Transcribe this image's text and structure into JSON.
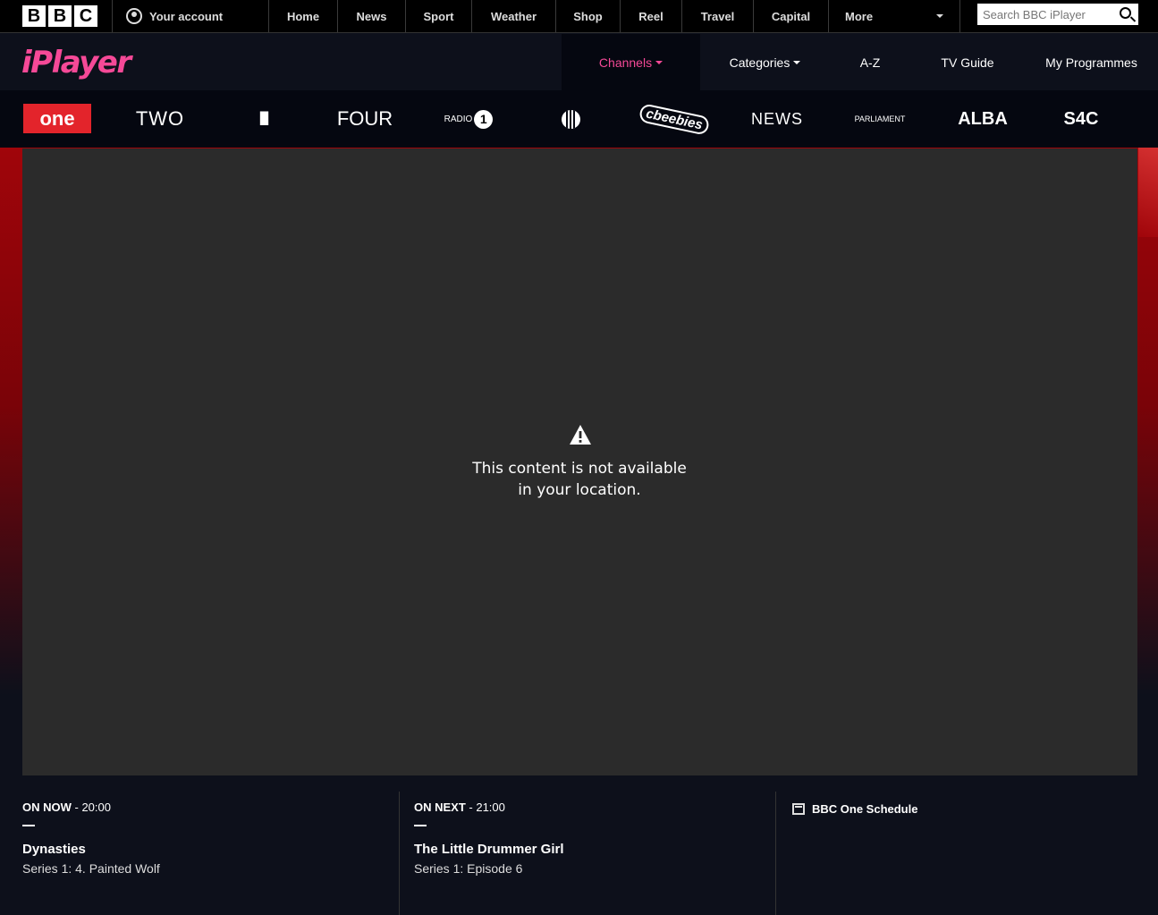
{
  "global_nav": {
    "bbc_letters": [
      "B",
      "B",
      "C"
    ],
    "account_label": "Your account",
    "items": [
      "Home",
      "News",
      "Sport",
      "Weather",
      "Shop",
      "Reel",
      "Travel",
      "Capital"
    ],
    "more_label": "More",
    "search_placeholder": "Search BBC iPlayer"
  },
  "iplayer": {
    "logo_text": "iPlayer",
    "tabs": [
      "Channels",
      "Categories",
      "A-Z",
      "TV Guide",
      "My Programmes"
    ],
    "active_tab": "Channels",
    "brand_color": "#f54997"
  },
  "channels": {
    "one": "one",
    "two": "TWO",
    "three": "III",
    "four": "FOUR",
    "radio1_label": "RADIO",
    "radio1_num": "1",
    "cbeebies": "cbeebies",
    "news": "NEWS",
    "parliament": "PARLIAMENT",
    "alba": "ALBA",
    "s4c": "S4C",
    "one_color": "#e3242b"
  },
  "player": {
    "message_line1": "This content is not available",
    "message_line2": "in your location.",
    "icon": "warning-icon"
  },
  "schedule": {
    "now": {
      "label": "ON NOW",
      "time": " - 20:00",
      "title": "Dynasties",
      "episode": "Series 1: 4. Painted Wolf"
    },
    "next": {
      "label": "ON NEXT",
      "time": " - 21:00",
      "title": "The Little Drummer Girl",
      "episode": "Series 1: Episode 6"
    },
    "link_label": "BBC One Schedule"
  }
}
